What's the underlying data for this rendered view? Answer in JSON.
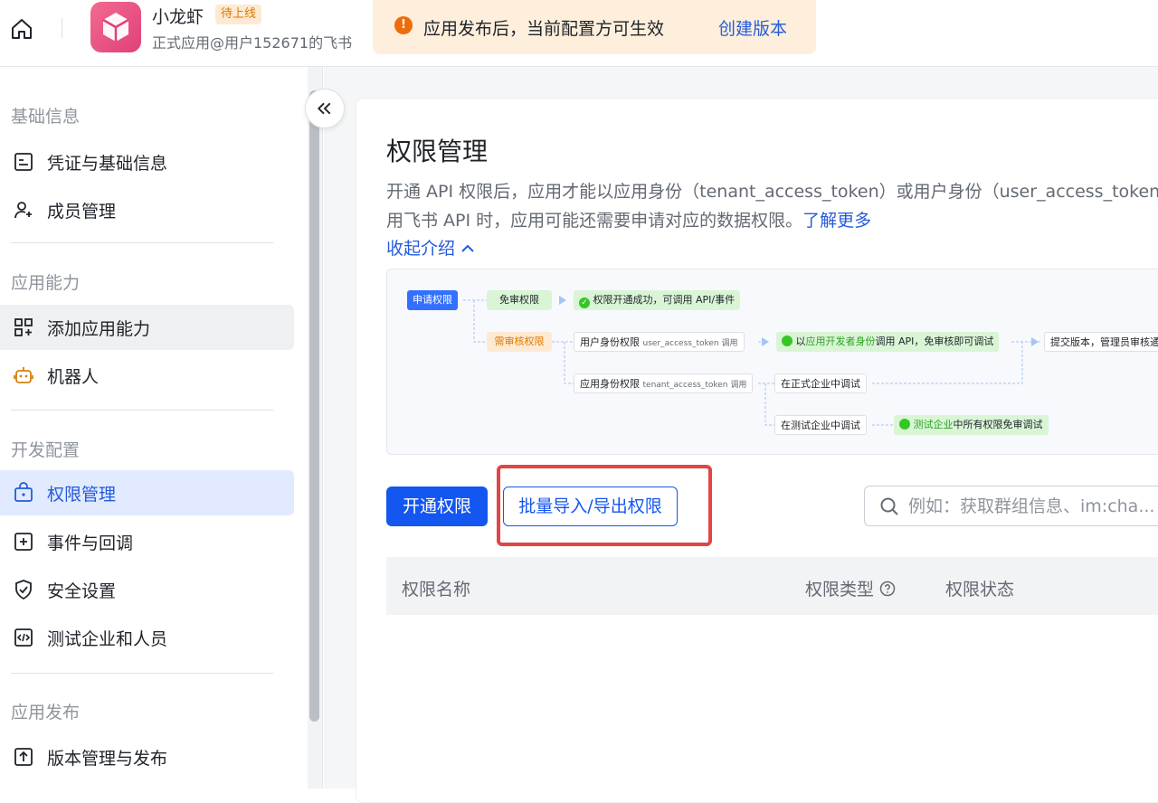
{
  "header": {
    "app_name": "小龙虾",
    "status_badge": "待上线",
    "app_subtitle": "正式应用@用户152671的飞书",
    "notice_text": "应用发布后，当前配置方可生效",
    "notice_link": "创建版本"
  },
  "sidebar": {
    "sections": [
      {
        "title": "基础信息",
        "items": [
          {
            "label": "凭证与基础信息",
            "icon": "credential-icon"
          },
          {
            "label": "成员管理",
            "icon": "member-add-icon"
          }
        ]
      },
      {
        "title": "应用能力",
        "items": [
          {
            "label": "添加应用能力",
            "icon": "app-grid-add-icon"
          },
          {
            "label": "机器人",
            "icon": "robot-icon"
          }
        ]
      },
      {
        "title": "开发配置",
        "items": [
          {
            "label": "权限管理",
            "icon": "permission-lock-icon"
          },
          {
            "label": "事件与回调",
            "icon": "event-plus-icon"
          },
          {
            "label": "安全设置",
            "icon": "shield-check-icon"
          },
          {
            "label": "测试企业和人员",
            "icon": "code-test-icon"
          }
        ]
      },
      {
        "title": "应用发布",
        "items": [
          {
            "label": "版本管理与发布",
            "icon": "upload-version-icon"
          }
        ]
      }
    ],
    "active_item": "权限管理",
    "hover_item": "添加应用能力"
  },
  "main": {
    "title": "权限管理",
    "desc_line1": "开通 API 权限后，应用才能以应用身份（tenant_access_token）或用户身份（user_access_token）",
    "desc_line2": "用飞书 API 时，应用可能还需要申请对应的数据权限。",
    "learn_more": "了解更多",
    "collapse_intro": "收起介绍",
    "flow": {
      "apply": "申请权限",
      "free": "免审权限",
      "free_result": "权限开通成功，可调用 API/事件",
      "review": "需审核权限",
      "user_perm": "用户身份权限",
      "user_token": "user_access_token 调用",
      "dev_pre": "以",
      "dev_highlight": "应用开发者身份",
      "dev_post": "调用 API，免审核即可调试",
      "submit": "提交版本，管理员审核通",
      "app_perm": "应用身份权限",
      "tenant_token": "tenant_access_token 调用",
      "prod_debug": "在正式企业中调试",
      "test_debug": "在测试企业中调试",
      "test_highlight": "测试企业",
      "test_post": "中所有权限免审调试"
    },
    "btn_enable": "开通权限",
    "btn_batch": "批量导入/导出权限",
    "search_placeholder": "例如：获取群组信息、im:cha...",
    "table_headers": {
      "name": "权限名称",
      "type": "权限类型",
      "status": "权限状态"
    }
  },
  "colors": {
    "primary": "#1456f0",
    "link": "#245bdb",
    "notice_bg": "#feefdc",
    "warning": "#ed6d0c",
    "highlight_box": "#e34444"
  }
}
